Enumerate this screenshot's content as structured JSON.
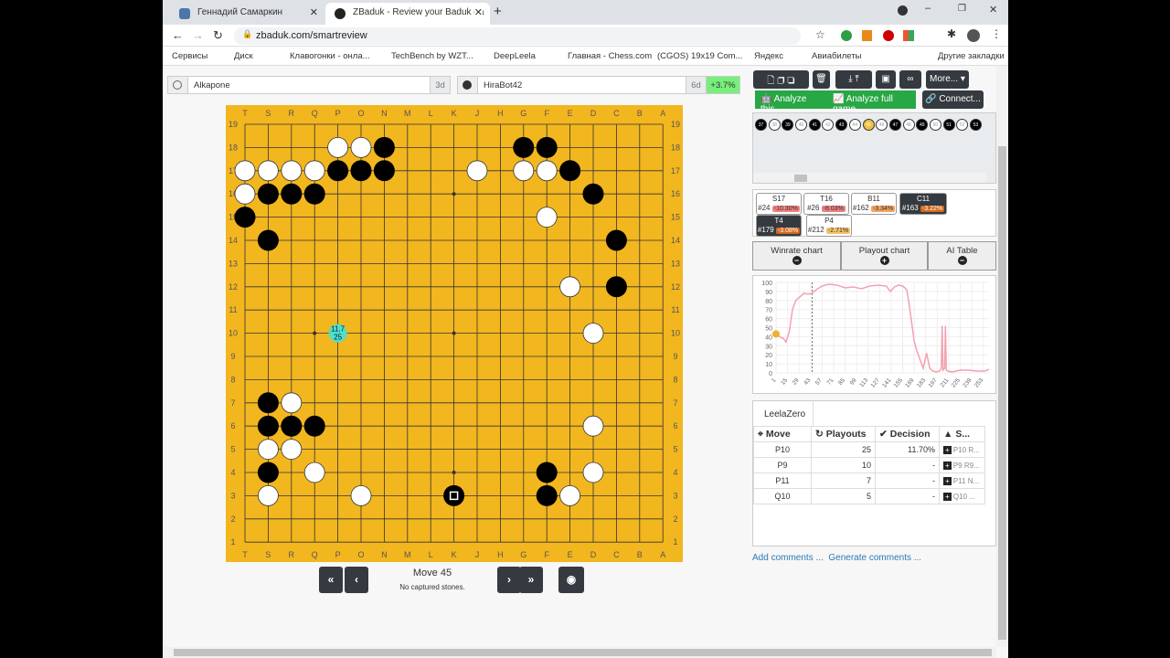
{
  "browser": {
    "tabs": [
      {
        "title": "Геннадий Самаркин"
      },
      {
        "title": "ZBaduk - Review your Baduk ga"
      }
    ],
    "url": "zbaduk.com/smartreview",
    "bookmarks": [
      "Сервисы",
      "Диск",
      "Клавогонки - онла...",
      "TechBench by WZT...",
      "DeepLeela",
      "Главная - Chess.com",
      "(CGOS) 19x19 Com...",
      "Яндекс",
      "Авиабилеты",
      "Другие закладки"
    ]
  },
  "players": {
    "white": {
      "name": "Alkapone",
      "rank": "3d"
    },
    "black": {
      "name": "HiraBot42",
      "rank": "6d",
      "delta": "+3.7%"
    }
  },
  "board": {
    "columns": [
      "T",
      "S",
      "R",
      "Q",
      "P",
      "O",
      "N",
      "M",
      "L",
      "K",
      "J",
      "H",
      "G",
      "F",
      "E",
      "D",
      "C",
      "B",
      "A"
    ],
    "rows": [
      "19",
      "18",
      "17",
      "16",
      "15",
      "14",
      "13",
      "12",
      "11",
      "10",
      "9",
      "8",
      "7",
      "6",
      "5",
      "4",
      "3",
      "2",
      "1"
    ],
    "black": [
      "N18",
      "G18",
      "F18",
      "P17",
      "O17",
      "N17",
      "E17",
      "S16",
      "R16",
      "Q16",
      "D16",
      "T15",
      "S14",
      "C14",
      "C12",
      "S7",
      "S6",
      "R6",
      "Q6",
      "S4",
      "F4",
      "K3",
      "F3"
    ],
    "white": [
      "P18",
      "O18",
      "T17",
      "S17",
      "R17",
      "Q17",
      "J17",
      "G17",
      "F17",
      "T16",
      "F15",
      "E12",
      "D10",
      "R7",
      "D6",
      "S5",
      "R5",
      "Q4",
      "D4",
      "S3",
      "O3",
      "E3"
    ],
    "last_move": "K3",
    "suggestion": {
      "point": "P10",
      "winrate": "11.7",
      "playouts": "25",
      "color": "#4ee0c8"
    }
  },
  "nav": {
    "move_label": "Move 45",
    "captured": "No captured stones.",
    "first": "«",
    "prev": "‹",
    "next": "›",
    "last": "»"
  },
  "toolbar": {
    "more": "More...",
    "analyze_this": "Analyze this",
    "analyze_full": "Analyze full game",
    "connect": "Connect..."
  },
  "timeline": [
    "37",
    "38",
    "39",
    "40",
    "41",
    "42",
    "43",
    "44",
    "45",
    "46",
    "47",
    "48",
    "49",
    "50",
    "51",
    "52",
    "53"
  ],
  "timeline_current": "45",
  "mistakes": [
    {
      "move": "S17",
      "num": "#24",
      "delta": "-10.30%",
      "dark": false,
      "color": "#f08080"
    },
    {
      "move": "T16",
      "num": "#26",
      "delta": "-8.03%",
      "dark": false,
      "color": "#f08080"
    },
    {
      "move": "B11",
      "num": "#162",
      "delta": "-3.34%",
      "dark": false,
      "color": "#f4a460"
    },
    {
      "move": "C11",
      "num": "#163",
      "delta": "-3.22%",
      "dark": true,
      "color": "#d2691e"
    },
    {
      "move": "T4",
      "num": "#179",
      "delta": "-3.08%",
      "dark": true,
      "color": "#d2691e"
    },
    {
      "move": "P4",
      "num": "#212",
      "delta": "-2.71%",
      "dark": false,
      "color": "#f5c26b"
    }
  ],
  "chart_tabs": [
    {
      "label": "Winrate chart",
      "state": "−"
    },
    {
      "label": "Playout chart",
      "state": "+"
    },
    {
      "label": "AI Table",
      "state": "−"
    }
  ],
  "chart_data": {
    "type": "line",
    "title": "",
    "xlabel": "",
    "ylabel": "",
    "ylim": [
      0,
      100
    ],
    "xlim": [
      1,
      260
    ],
    "yticks": [
      "0",
      "10",
      "20",
      "30",
      "40",
      "50",
      "60",
      "70",
      "80",
      "90",
      "100"
    ],
    "xticks": [
      "1",
      "15",
      "29",
      "43",
      "57",
      "71",
      "85",
      "99",
      "113",
      "127",
      "141",
      "155",
      "169",
      "183",
      "197",
      "211",
      "225",
      "239",
      "253"
    ],
    "current_move": 45,
    "current_value": 43,
    "color": "#f4a0b0",
    "x": [
      1,
      5,
      10,
      13,
      17,
      21,
      25,
      30,
      35,
      40,
      45,
      50,
      57,
      65,
      75,
      85,
      95,
      105,
      115,
      125,
      135,
      140,
      145,
      150,
      155,
      160,
      163,
      166,
      169,
      172,
      176,
      180,
      184,
      188,
      192,
      196,
      200,
      202,
      203,
      204,
      206,
      207,
      208,
      210,
      215,
      225,
      235,
      245,
      255,
      260
    ],
    "y": [
      45,
      40,
      38,
      34,
      45,
      70,
      80,
      84,
      88,
      87,
      88,
      92,
      96,
      98,
      97,
      94,
      95,
      93,
      96,
      97,
      96,
      90,
      95,
      97,
      96,
      92,
      75,
      55,
      35,
      25,
      15,
      5,
      22,
      5,
      2,
      1,
      2,
      5,
      52,
      3,
      5,
      52,
      3,
      2,
      1,
      3,
      3,
      2,
      2,
      4
    ]
  },
  "ai": {
    "engine": "LeelaZero",
    "headers": [
      "Move",
      "Playouts",
      "Decision",
      "S..."
    ],
    "rows": [
      {
        "move": "P10",
        "playouts": "25",
        "decision": "11.70%",
        "seq": "P10 R..."
      },
      {
        "move": "P9",
        "playouts": "10",
        "decision": "-",
        "seq": "P9 R9..."
      },
      {
        "move": "P11",
        "playouts": "7",
        "decision": "-",
        "seq": "P11 N..."
      },
      {
        "move": "Q10",
        "playouts": "5",
        "decision": "-",
        "seq": "Q10 ..."
      }
    ]
  },
  "links": {
    "add": "Add comments ...",
    "generate": "Generate comments ..."
  }
}
